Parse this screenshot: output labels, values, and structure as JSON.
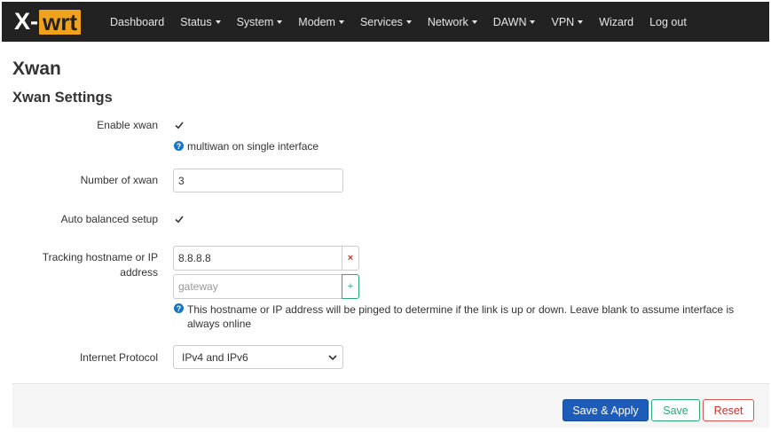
{
  "brand": {
    "x": "X-",
    "wrt": "wrt"
  },
  "menu": [
    {
      "label": "Dashboard",
      "caret": false
    },
    {
      "label": "Status",
      "caret": true
    },
    {
      "label": "System",
      "caret": true
    },
    {
      "label": "Modem",
      "caret": true
    },
    {
      "label": "Services",
      "caret": true
    },
    {
      "label": "Network",
      "caret": true
    },
    {
      "label": "DAWN",
      "caret": true
    },
    {
      "label": "VPN",
      "caret": true
    },
    {
      "label": "Wizard",
      "caret": false
    },
    {
      "label": "Log out",
      "caret": false
    }
  ],
  "page": {
    "title": "Xwan",
    "section_title": "Xwan Settings"
  },
  "form": {
    "enable_xwan": {
      "label": "Enable xwan",
      "checked": true,
      "help": "multiwan on single interface"
    },
    "number_of_xwan": {
      "label": "Number of xwan",
      "value": "3"
    },
    "auto_balanced": {
      "label": "Auto balanced setup",
      "checked": true
    },
    "tracking": {
      "label": "Tracking hostname or IP address",
      "value": "8.8.8.8",
      "placeholder": "gateway",
      "remove_symbol": "×",
      "add_symbol": "+",
      "help": "This hostname or IP address will be pinged to determine if the link is up or down. Leave blank to assume interface is always online"
    },
    "internet_protocol": {
      "label": "Internet Protocol",
      "value": "IPv4 and IPv6"
    }
  },
  "actions": {
    "save_apply": "Save & Apply",
    "save": "Save",
    "reset": "Reset"
  },
  "colors": {
    "navbar": "#222222",
    "brand_accent": "#f0a21c",
    "primary": "#1d5cb8",
    "positive": "#2aa87a",
    "negative": "#c9302c",
    "help_icon": "#1a74c4"
  }
}
